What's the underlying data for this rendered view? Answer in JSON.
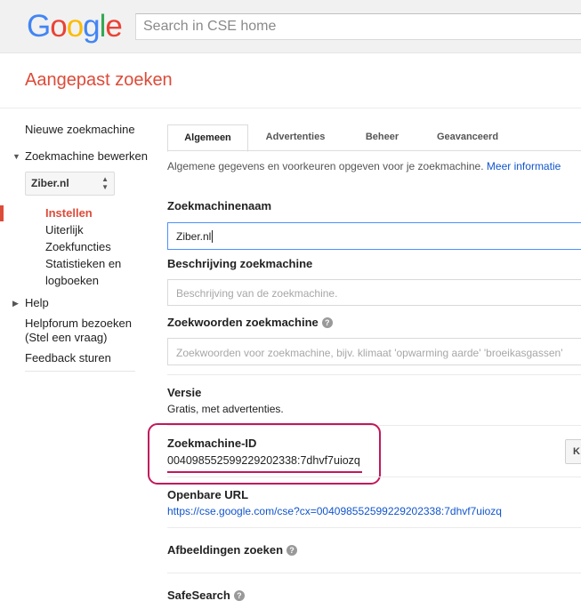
{
  "header": {
    "logo_letters": [
      "G",
      "o",
      "o",
      "g",
      "l",
      "e"
    ],
    "search_placeholder": "Search in CSE home",
    "title": "Aangepast zoeken"
  },
  "sidebar": {
    "new_engine": "Nieuwe zoekmachine",
    "edit_engine": "Zoekmachine bewerken",
    "selected_engine": "Ziber.nl",
    "sub_items": [
      "Instellen",
      "Uiterlijk",
      "Zoekfuncties",
      "Statistieken en",
      "logboeken"
    ],
    "help": "Help",
    "forum_line1": "Helpforum bezoeken",
    "forum_line2": "(Stel een vraag)",
    "feedback": "Feedback sturen"
  },
  "tabs": [
    "Algemeen",
    "Advertenties",
    "Beheer",
    "Geavanceerd"
  ],
  "intro": {
    "text": "Algemene gegevens en voorkeuren opgeven voor je zoekmachine.",
    "link": "Meer informatie"
  },
  "form": {
    "name_label": "Zoekmachinenaam",
    "name_value": "Ziber.nl",
    "desc_label": "Beschrijving zoekmachine",
    "desc_placeholder": "Beschrijving van de zoekmachine.",
    "keywords_label": "Zoekwoorden zoekmachine",
    "keywords_placeholder": "Zoekwoorden voor zoekmachine, bijv. klimaat 'opwarming aarde' 'broeikasgassen'",
    "version_label": "Versie",
    "version_value": "Gratis, met advertenties.",
    "id_label": "Zoekmachine-ID",
    "id_value": "004098552599229202338:7dhvf7uiozq",
    "copy_button": "K",
    "public_url_label": "Openbare URL",
    "public_url": "https://cse.google.com/cse?cx=004098552599229202338:7dhvf7uiozq",
    "image_search_label": "Afbeeldingen zoeken",
    "safesearch_label": "SafeSearch"
  },
  "colors": {
    "accent_red": "#dd4b39",
    "link_blue": "#1155cc",
    "highlight": "#c2185b",
    "logo": [
      "#4285f4",
      "#ea4335",
      "#fbbc05",
      "#4285f4",
      "#34a853",
      "#ea4335"
    ]
  }
}
